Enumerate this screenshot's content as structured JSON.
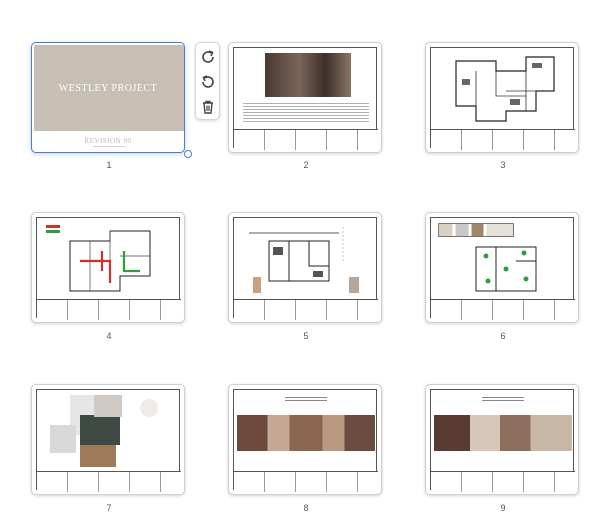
{
  "pages": [
    {
      "number": "1",
      "title": "WESTLEY PROJECT",
      "subtitle": "REVISION 00",
      "selected": true
    },
    {
      "number": "2"
    },
    {
      "number": "3"
    },
    {
      "number": "4"
    },
    {
      "number": "5"
    },
    {
      "number": "6"
    },
    {
      "number": "7"
    },
    {
      "number": "8"
    },
    {
      "number": "9"
    }
  ],
  "toolbar": {
    "rotate_right": "rotate-clockwise-icon",
    "rotate_left": "rotate-counterclockwise-icon",
    "delete": "trash-icon"
  },
  "colors": {
    "accent": "#4a7bd8",
    "cover": "#c8bfb4",
    "plan_red": "#d32f2f",
    "plan_green": "#2e9d3a"
  }
}
